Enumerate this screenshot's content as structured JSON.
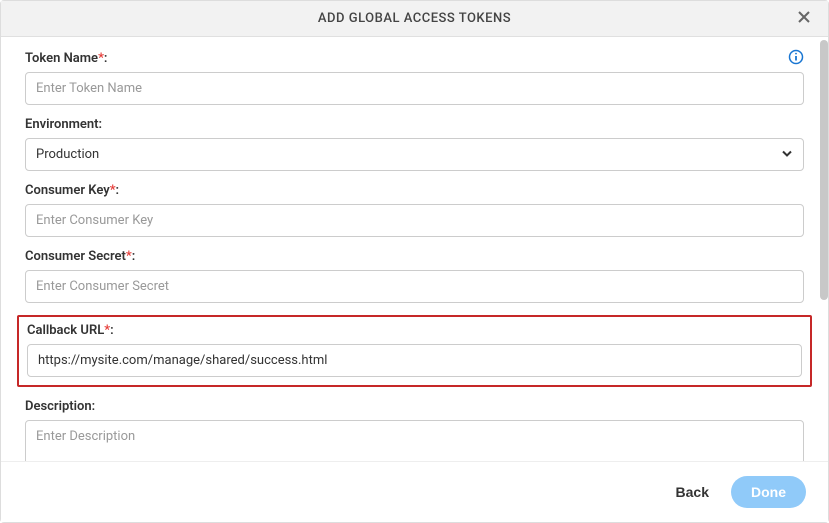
{
  "header": {
    "title": "ADD GLOBAL ACCESS TOKENS"
  },
  "form": {
    "tokenName": {
      "label": "Token Name",
      "placeholder": "Enter Token Name",
      "value": ""
    },
    "environment": {
      "label": "Environment:",
      "value": "Production"
    },
    "consumerKey": {
      "label": "Consumer Key",
      "placeholder": "Enter Consumer Key",
      "value": ""
    },
    "consumerSecret": {
      "label": "Consumer Secret",
      "placeholder": "Enter Consumer Secret",
      "value": ""
    },
    "callbackUrl": {
      "label": "Callback URL",
      "value": "https://mysite.com/manage/shared/success.html"
    },
    "description": {
      "label": "Description:",
      "placeholder": "Enter Description",
      "value": ""
    }
  },
  "footer": {
    "back": "Back",
    "done": "Done"
  },
  "required": "*",
  "colon": ":"
}
